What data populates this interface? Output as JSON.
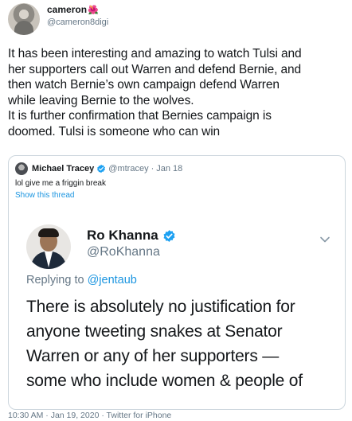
{
  "tweet": {
    "author": {
      "display_name": "cameron",
      "name_emoji": "🌺",
      "handle": "@cameron8digi",
      "avatar": "user-avatar"
    },
    "text_lines": [
      "It has been interesting and amazing to watch Tulsi and",
      "her supporters call out Warren and defend Bernie, and",
      "then watch Bernie’s own campaign defend Warren",
      "while leaving Bernie to the wolves.",
      "It is further confirmation that Bernies campaign is",
      "doomed. Tulsi is someone who can win"
    ],
    "footer": "10:30 AM · Jan 19, 2020 · Twitter for iPhone"
  },
  "quote": {
    "author": {
      "display_name": "Michael Tracey",
      "verified": true,
      "handle": "@mtracey",
      "date": "Jan 18",
      "separator": "·"
    },
    "text": "lol give me a friggin break",
    "show_thread": "Show this thread",
    "embedded": {
      "display_name": "Ro Khanna",
      "verified": true,
      "handle": "@RoKhanna",
      "replying_prefix": "Replying to",
      "replying_to": "@jentaub",
      "text_lines": [
        "There is absolutely no justification for",
        "anyone tweeting snakes at Senator",
        "Warren or any of her supporters —",
        "some who include women & people of"
      ],
      "menu_icon": "chevron-down-icon"
    }
  },
  "colors": {
    "text": "#14171a",
    "secondary": "#657786",
    "link": "#1b95e0",
    "border": "#ccd6dd",
    "verified": "#1da1f2"
  }
}
